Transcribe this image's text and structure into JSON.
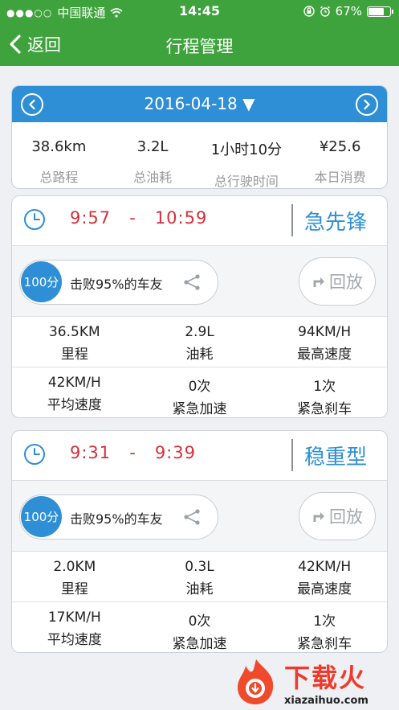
{
  "status_bar": {
    "signal": "●●●○○",
    "carrier": "中国联通",
    "time": "14:45",
    "battery": "67%"
  },
  "nav": {
    "back_label": "返回",
    "title": "行程管理"
  },
  "summary": {
    "date": "2016-04-18",
    "date_arrow": "▼",
    "stats": [
      {
        "value": "38.6km",
        "label": "总路程"
      },
      {
        "value": "3.2L",
        "label": "总油耗"
      },
      {
        "value": "1小时10分",
        "label": "总行驶时间"
      },
      {
        "value": "¥25.6",
        "label": "本日消费"
      }
    ]
  },
  "trips": [
    {
      "start": "9:57",
      "separator": "-",
      "end": "10:59",
      "style": "急先锋",
      "score": "100分",
      "beat": "击败95%的车友",
      "replay": "回放",
      "metrics": [
        {
          "value": "36.5KM",
          "label": "里程"
        },
        {
          "value": "2.9L",
          "label": "油耗"
        },
        {
          "value": "94KM/H",
          "label": "最高速度"
        },
        {
          "value": "42KM/H",
          "label": "平均速度"
        },
        {
          "value": "0次",
          "label": "紧急加速"
        },
        {
          "value": "1次",
          "label": "紧急刹车"
        }
      ]
    },
    {
      "start": "9:31",
      "separator": "-",
      "end": "9:39",
      "style": "稳重型",
      "score": "100分",
      "beat": "击败95%的车友",
      "replay": "回放",
      "metrics": [
        {
          "value": "2.0KM",
          "label": "里程"
        },
        {
          "value": "0.3L",
          "label": "油耗"
        },
        {
          "value": "42KM/H",
          "label": "最高速度"
        },
        {
          "value": "17KM/H",
          "label": "平均速度"
        },
        {
          "value": "0次",
          "label": "紧急加速"
        },
        {
          "value": "1次",
          "label": "紧急刹车"
        }
      ]
    }
  ],
  "watermark": {
    "name": "下载火",
    "site": "xiazaihuo.com"
  },
  "colors": {
    "header_green": "#3fa33d",
    "accent_blue": "#2e8fd6",
    "time_red": "#d4303a"
  }
}
